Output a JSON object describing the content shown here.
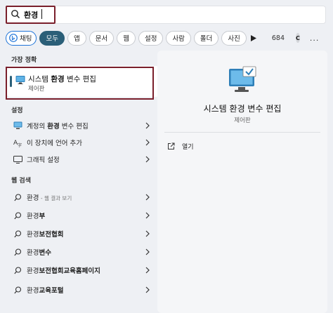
{
  "search": {
    "query": "환경"
  },
  "filters": {
    "chat": "채팅",
    "items": [
      "모두",
      "앱",
      "문서",
      "웹",
      "설정",
      "사람",
      "폴더",
      "사진"
    ],
    "count": "684",
    "badge": "C",
    "more": "..."
  },
  "best_match": {
    "section": "가장 정확",
    "title_pre": "시스템 ",
    "title_bold": "환경",
    "title_post": " 변수 편집",
    "subtitle": "제어판"
  },
  "settings": {
    "section": "설정",
    "items": [
      {
        "pre": "계정의 ",
        "bold": "환경",
        "post": " 변수 편집"
      },
      {
        "pre": "이 장치에 언어 추가",
        "bold": "",
        "post": ""
      },
      {
        "pre": "그래픽 설정",
        "bold": "",
        "post": ""
      }
    ]
  },
  "web": {
    "section": "웹 검색",
    "items": [
      {
        "pre": "환경",
        "bold": "",
        "post": "",
        "muted": " - 웹 결과 보기"
      },
      {
        "pre": "환경",
        "bold": "부",
        "post": "",
        "muted": ""
      },
      {
        "pre": "환경",
        "bold": "보전협회",
        "post": "",
        "muted": ""
      },
      {
        "pre": "환경",
        "bold": "변수",
        "post": "",
        "muted": ""
      },
      {
        "pre": "환경",
        "bold": "보전협회교육홈페이지",
        "post": "",
        "muted": ""
      },
      {
        "pre": "환경",
        "bold": "교육포털",
        "post": "",
        "muted": ""
      }
    ]
  },
  "detail": {
    "title": "시스템 환경 변수 편집",
    "subtitle": "제어판",
    "open_label": "열기"
  },
  "colors": {
    "accent": "#2b5f78",
    "highlight": "#7a1f2b",
    "bing": "#1e73d8"
  }
}
